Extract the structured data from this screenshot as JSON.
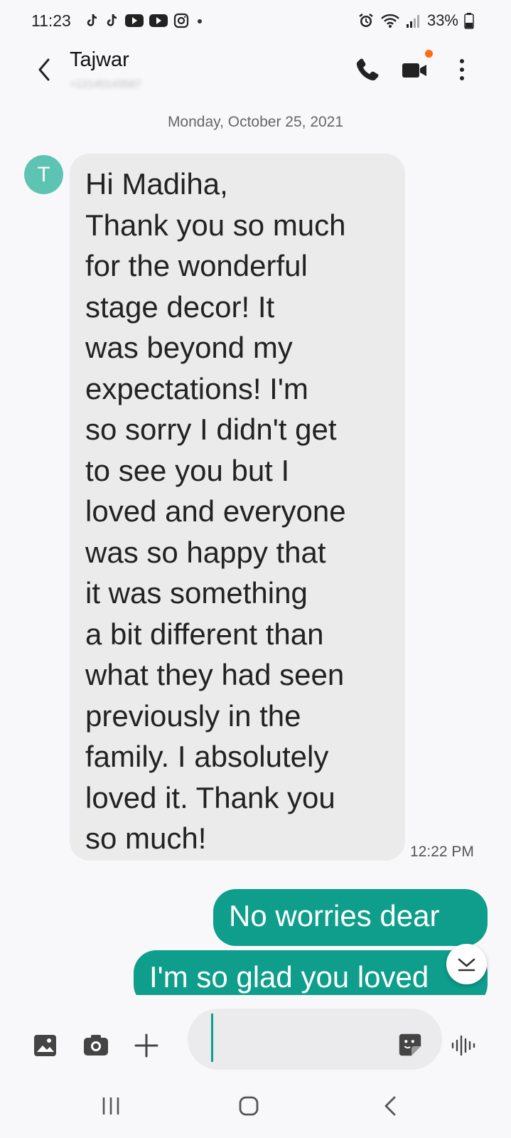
{
  "status": {
    "time": "11:23",
    "battery": "33%",
    "left_icons": [
      "tiktok-icon",
      "tiktok-icon",
      "youtube-icon",
      "youtube-icon",
      "instagram-icon",
      "dot-icon"
    ],
    "right_icons": [
      "alarm-icon",
      "wifi-icon",
      "signal-icon",
      "battery-icon"
    ]
  },
  "header": {
    "contact_name": "Tajwar",
    "icons": [
      "back-icon",
      "phone-icon",
      "video-call-icon",
      "more-icon"
    ],
    "video_badge_color": "#ff6a13"
  },
  "conversation": {
    "date_separator": "Monday, October 25, 2021",
    "avatar_initial": "T",
    "avatar_color": "#5dc3b2",
    "incoming": {
      "lines": "Hi Madiha,\nThank you so much\nfor the wonderful\nstage decor! It\nwas beyond my\nexpectations! I'm\nso sorry I didn't get\nto see you but I\nloved and everyone\nwas so happy that\nit was something\na bit different than\nwhat they had seen\npreviously in the\nfamily. I absolutely\nloved it. Thank you\nso much!",
      "time": "12:22 PM"
    },
    "outgoing": [
      "No worries dear",
      "I'm so glad you loved"
    ],
    "outgoing_color": "#0f9e8c"
  },
  "composer": {
    "icons": [
      "gallery-icon",
      "camera-icon",
      "plus-icon",
      "sticker-icon",
      "voice-icon"
    ],
    "input_value": ""
  },
  "navbar": {
    "icons": [
      "recents-icon",
      "home-icon",
      "nav-back-icon"
    ]
  }
}
